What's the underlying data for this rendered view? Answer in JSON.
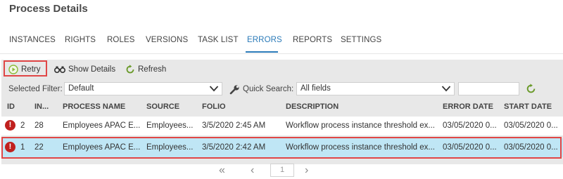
{
  "page_title": "Process Details",
  "tabs": [
    {
      "label": "INSTANCES",
      "active": false
    },
    {
      "label": "RIGHTS",
      "active": false
    },
    {
      "label": "ROLES",
      "active": false
    },
    {
      "label": "VERSIONS",
      "active": false
    },
    {
      "label": "TASK LIST",
      "active": false
    },
    {
      "label": "ERRORS",
      "active": true
    },
    {
      "label": "REPORTS",
      "active": false
    },
    {
      "label": "SETTINGS",
      "active": false
    }
  ],
  "toolbar": {
    "retry_label": "Retry",
    "show_details_label": "Show Details",
    "refresh_label": "Refresh"
  },
  "filters": {
    "selected_filter_label": "Selected Filter:",
    "selected_filter_value": "Default",
    "quick_search_label": "Quick Search:",
    "quick_search_scope": "All fields",
    "quick_search_text": ""
  },
  "grid": {
    "columns": [
      "ID",
      "IN...",
      "PROCESS NAME",
      "SOURCE",
      "FOLIO",
      "DESCRIPTION",
      "ERROR DATE",
      "START DATE"
    ],
    "rows": [
      {
        "id": "2",
        "instance": "28",
        "process_name": "Employees APAC E...",
        "source": "Employees...",
        "folio": "3/5/2020 2:45 AM",
        "description": "Workflow process instance threshold ex...",
        "error_date": "03/05/2020 0...",
        "start_date": "03/05/2020 0...",
        "selected": false
      },
      {
        "id": "1",
        "instance": "22",
        "process_name": "Employees APAC E...",
        "source": "Employees...",
        "folio": "3/5/2020 2:42 AM",
        "description": "Workflow process instance threshold ex...",
        "error_date": "03/05/2020 0...",
        "start_date": "03/05/2020 0...",
        "selected": true
      }
    ]
  },
  "pager": {
    "current_page": "1"
  },
  "colors": {
    "accent": "#2a7ab8",
    "highlight_border": "#e04646",
    "selected_row": "#bfe6f5",
    "error_icon": "#c0201e",
    "retry_icon": "#8bbb3a",
    "refresh_icon": "#6a9a2a"
  },
  "icons": [
    "play-circle-icon",
    "binoculars-icon",
    "refresh-icon",
    "wrench-icon",
    "chevron-down-icon",
    "error-icon",
    "first-page-icon",
    "prev-page-icon",
    "next-page-icon"
  ]
}
